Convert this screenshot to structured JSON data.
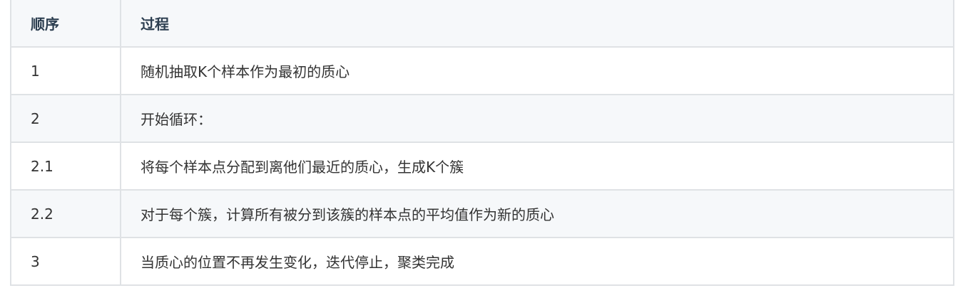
{
  "table": {
    "headers": [
      "顺序",
      "过程"
    ],
    "rows": [
      {
        "order": "1",
        "process": "随机抽取K个样本作为最初的质心"
      },
      {
        "order": "2",
        "process": "开始循环："
      },
      {
        "order": "2.1",
        "process": "将每个样本点分配到离他们最近的质心，生成K个簇"
      },
      {
        "order": "2.2",
        "process": "对于每个簇，计算所有被分到该簇的样本点的平均值作为新的质心"
      },
      {
        "order": "3",
        "process": "当质心的位置不再发生变化，迭代停止，聚类完成"
      }
    ]
  }
}
